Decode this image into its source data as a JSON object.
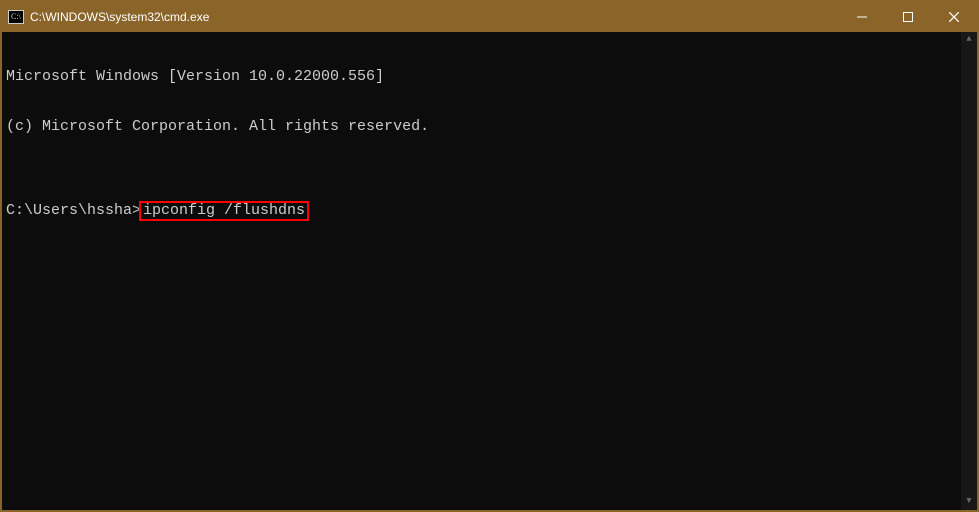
{
  "titlebar": {
    "title": "C:\\WINDOWS\\system32\\cmd.exe"
  },
  "terminal": {
    "line1": "Microsoft Windows [Version 10.0.22000.556]",
    "line2": "(c) Microsoft Corporation. All rights reserved.",
    "blank": "",
    "prompt": "C:\\Users\\hssha>",
    "command": "ipconfig /flushdns"
  }
}
